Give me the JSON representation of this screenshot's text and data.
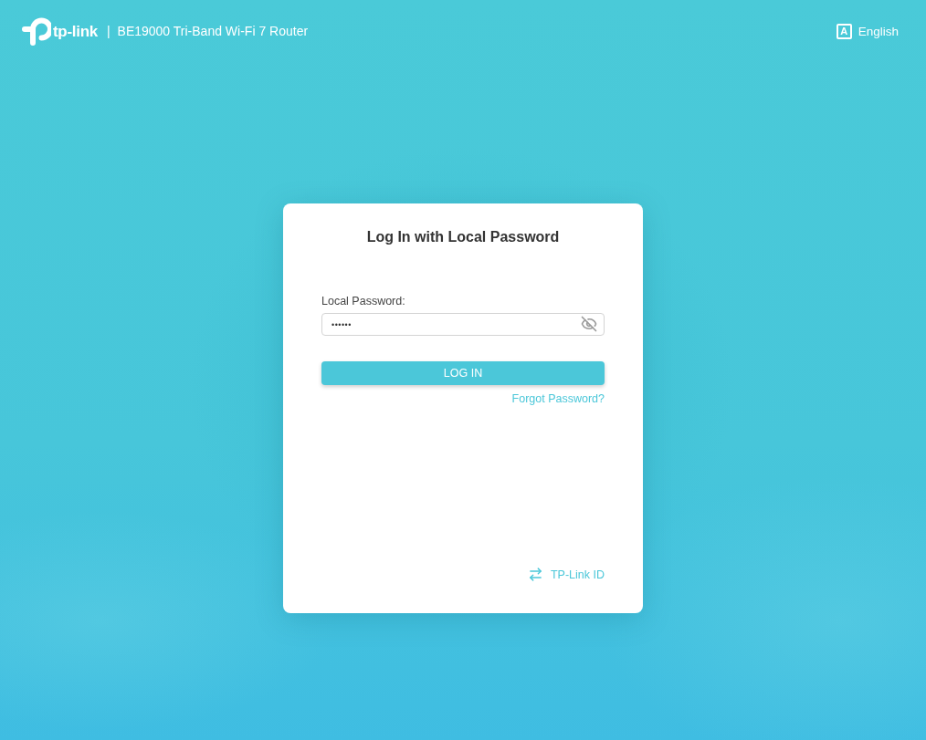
{
  "header": {
    "logo_text": "tp-link",
    "separator": "|",
    "product": "BE19000 Tri-Band Wi-Fi 7 Router",
    "language": {
      "icon": "A",
      "label": "English"
    }
  },
  "login": {
    "title": "Log In with Local Password",
    "password": {
      "label": "Local Password:",
      "value": "••••••",
      "visible": false
    },
    "button": "LOG IN",
    "forgot": "Forgot Password?",
    "switch": "TP-Link ID"
  }
}
